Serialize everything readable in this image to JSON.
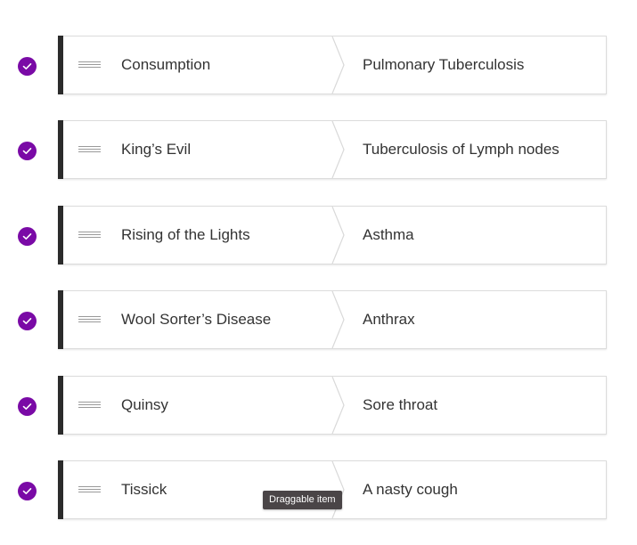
{
  "accent_color": "#7a0aa6",
  "status_icon": "check-circle-icon",
  "handle_icon": "drag-handle-icon",
  "pairs": [
    {
      "term": "Consumption",
      "match": "Pulmonary Tuberculosis"
    },
    {
      "term": "King’s Evil",
      "match": "Tuberculosis of Lymph nodes"
    },
    {
      "term": "Rising of the Lights",
      "match": "Asthma"
    },
    {
      "term": "Wool Sorter’s Disease",
      "match": "Anthrax"
    },
    {
      "term": "Quinsy",
      "match": "Sore throat"
    },
    {
      "term": "Tissick",
      "match": "A nasty cough"
    }
  ],
  "tooltip": {
    "label": "Draggable item"
  }
}
